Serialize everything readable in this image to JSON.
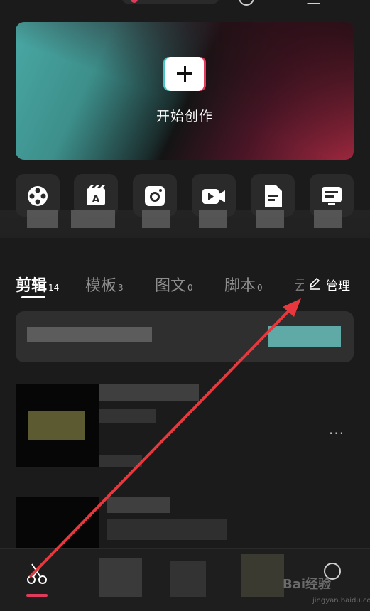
{
  "hero": {
    "start_label": "开始创作"
  },
  "tools": [
    {
      "icon": "film-reel-icon"
    },
    {
      "icon": "text-clapper-icon"
    },
    {
      "icon": "camera-icon"
    },
    {
      "icon": "video-camera-icon"
    },
    {
      "icon": "document-icon"
    },
    {
      "icon": "subtitle-icon"
    }
  ],
  "tabs": [
    {
      "label": "剪辑",
      "count": "14",
      "active": true
    },
    {
      "label": "模板",
      "count": "3"
    },
    {
      "label": "图文",
      "count": "0"
    },
    {
      "label": "脚本",
      "count": "0"
    },
    {
      "label": "云",
      "count": ""
    }
  ],
  "manage_label": "管理",
  "more_label": "···",
  "watermark": {
    "text": "Bai经验",
    "sub": "jingyan.baidu.com"
  },
  "colors": {
    "accent": "#e23a5a",
    "teal": "#49a8a4",
    "arrow": "#e8383d"
  }
}
